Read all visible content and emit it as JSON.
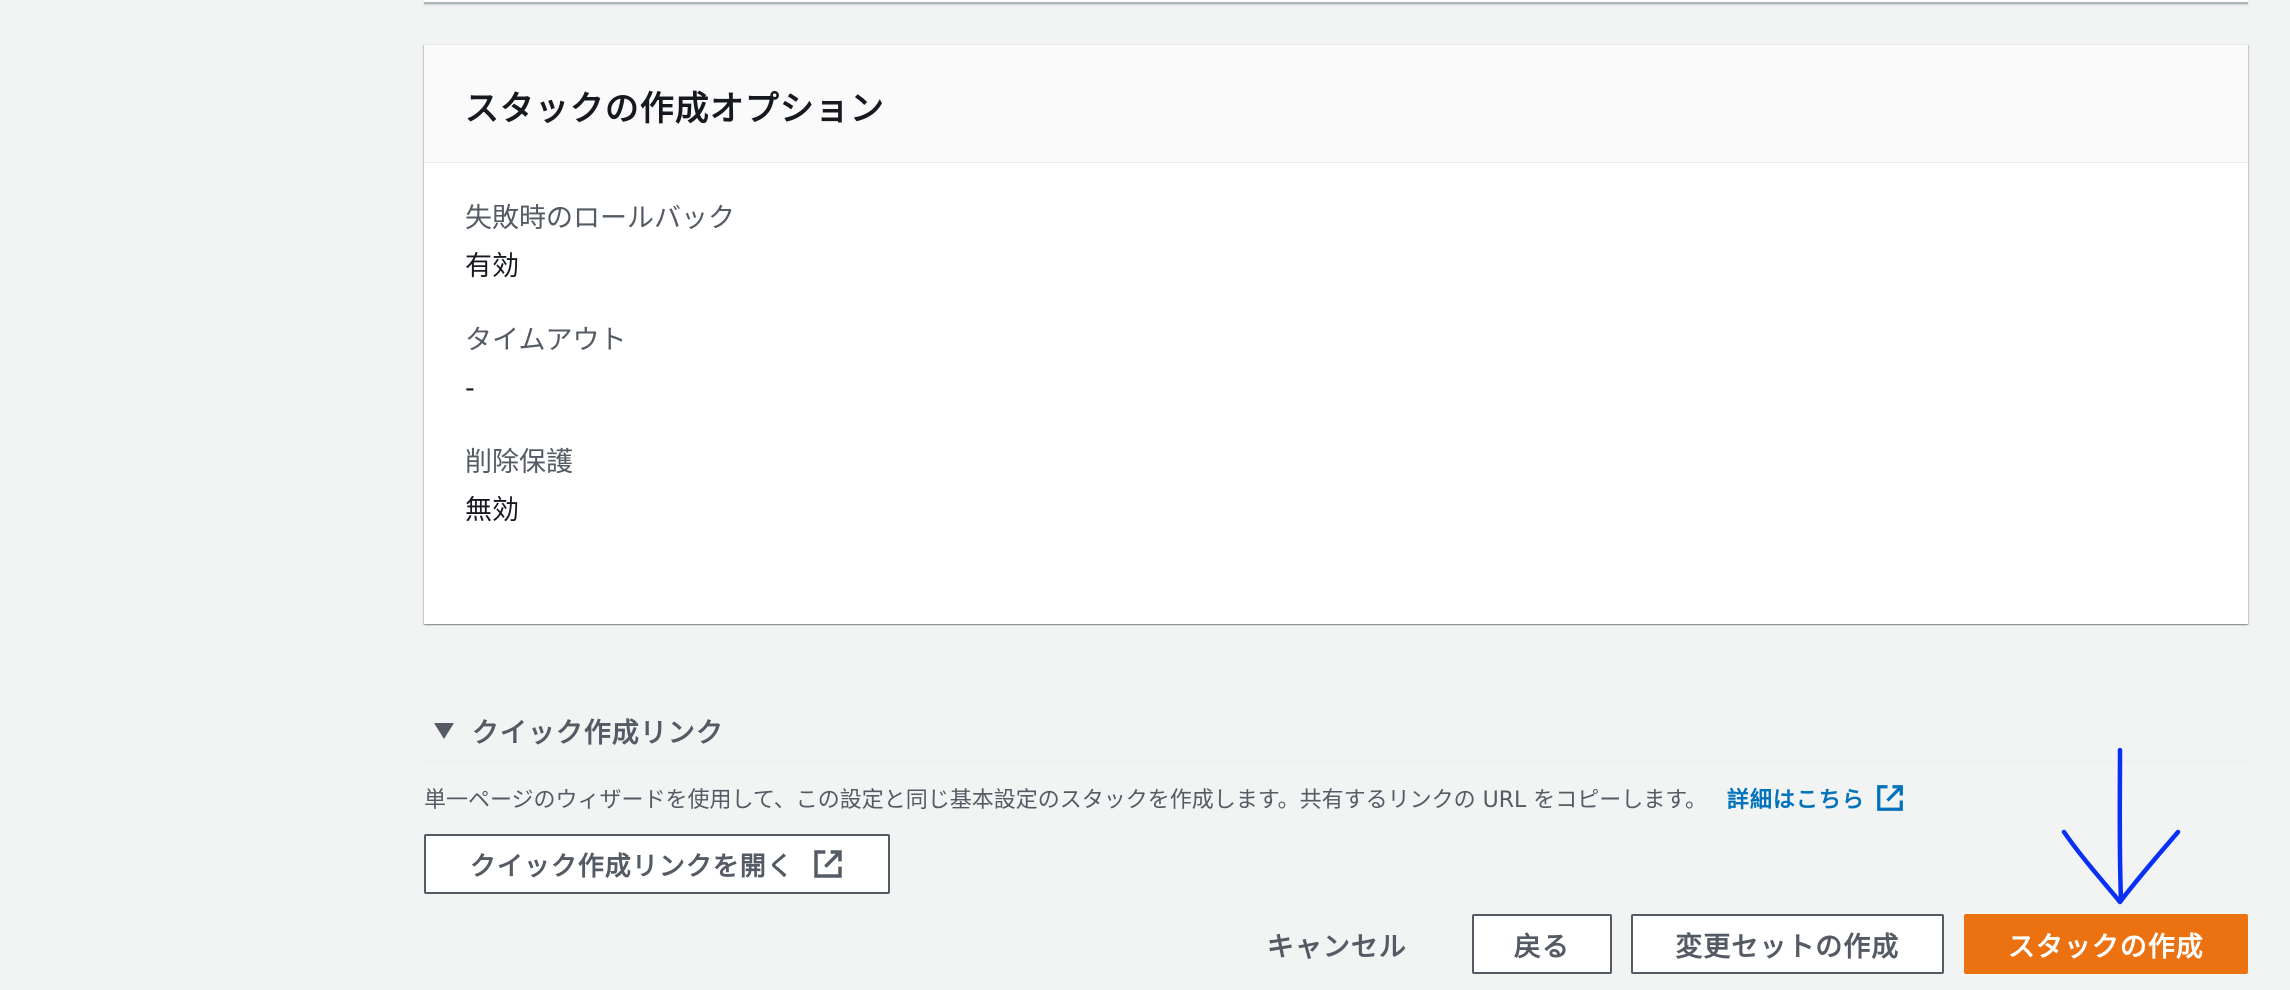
{
  "options_panel": {
    "title": "スタックの作成オプション",
    "fields": [
      {
        "label": "失敗時のロールバック",
        "value": "有効"
      },
      {
        "label": "タイムアウト",
        "value": "-"
      },
      {
        "label": "削除保護",
        "value": "無効"
      }
    ]
  },
  "quick_create": {
    "title": "クイック作成リンク",
    "description": "単一ページのウィザードを使用して、この設定と同じ基本設定のスタックを作成します。共有するリンクの URL をコピーします。",
    "learn_more": "詳細はこちら",
    "open_button": "クイック作成リンクを開く"
  },
  "footer": {
    "cancel": "キャンセル",
    "back": "戻る",
    "create_changeset": "変更セットの作成",
    "create_stack": "スタックの作成"
  },
  "colors": {
    "primary": "#ec7211",
    "link": "#0073bb",
    "annotation": "#0a2ff5"
  },
  "icons": [
    "triangle-down-icon",
    "external-link-icon",
    "annotation-arrow"
  ]
}
